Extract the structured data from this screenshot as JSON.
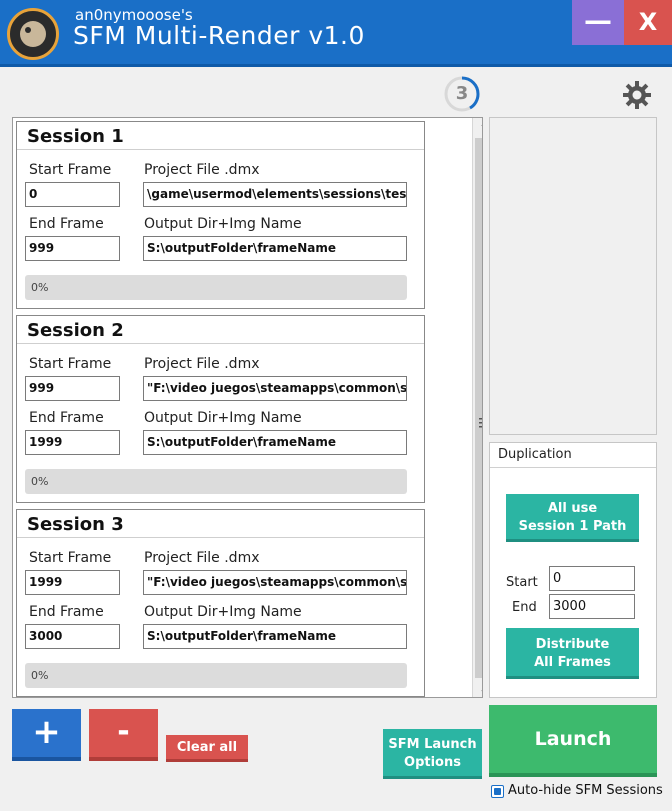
{
  "window": {
    "author": "an0nymooose's",
    "title": "SFM Multi-Render v1.0",
    "minimize_label": "—",
    "close_label": "X"
  },
  "counter": {
    "value": "3"
  },
  "sessions": [
    {
      "title": "Session 1",
      "start_label": "Start Frame",
      "start_value": "0",
      "end_label": "End Frame",
      "end_value": "999",
      "project_label": "Project File .dmx",
      "project_value": "\\game\\usermod\\elements\\sessions\\test.d",
      "output_label": "Output Dir+Img Name",
      "output_value": "S:\\outputFolder\\frameName",
      "progress": "0%"
    },
    {
      "title": "Session 2",
      "start_label": "Start Frame",
      "start_value": "999",
      "end_label": "End Frame",
      "end_value": "1999",
      "project_label": "Project File .dmx",
      "project_value": "\"F:\\video juegos\\steamapps\\common\\sou",
      "output_label": "Output Dir+Img Name",
      "output_value": "S:\\outputFolder\\frameName",
      "progress": "0%"
    },
    {
      "title": "Session 3",
      "start_label": "Start Frame",
      "start_value": "1999",
      "end_label": "End Frame",
      "end_value": "3000",
      "project_label": "Project File .dmx",
      "project_value": "\"F:\\video juegos\\steamapps\\common\\sou",
      "output_label": "Output Dir+Img Name",
      "output_value": "S:\\outputFolder\\frameName",
      "progress": "0%"
    }
  ],
  "duplication": {
    "title": "Duplication",
    "all_use_line1": "All use",
    "all_use_line2": "Session 1 Path",
    "start_label": "Start",
    "start_value": "0",
    "end_label": "End",
    "end_value": "3000",
    "distribute_line1": "Distribute",
    "distribute_line2": "All Frames"
  },
  "buttons": {
    "add": "+",
    "remove": "-",
    "clear_all": "Clear all",
    "launch_options_line1": "SFM Launch",
    "launch_options_line2": "Options",
    "launch": "Launch"
  },
  "autohide": {
    "label": "Auto-hide SFM Sessions",
    "checked": true
  },
  "colors": {
    "titlebar": "#1a6fc7",
    "minimize": "#8a6fd6",
    "close": "#d9534f",
    "teal": "#2bb5a3",
    "launch": "#3dba6d",
    "add": "#2a72cc"
  }
}
